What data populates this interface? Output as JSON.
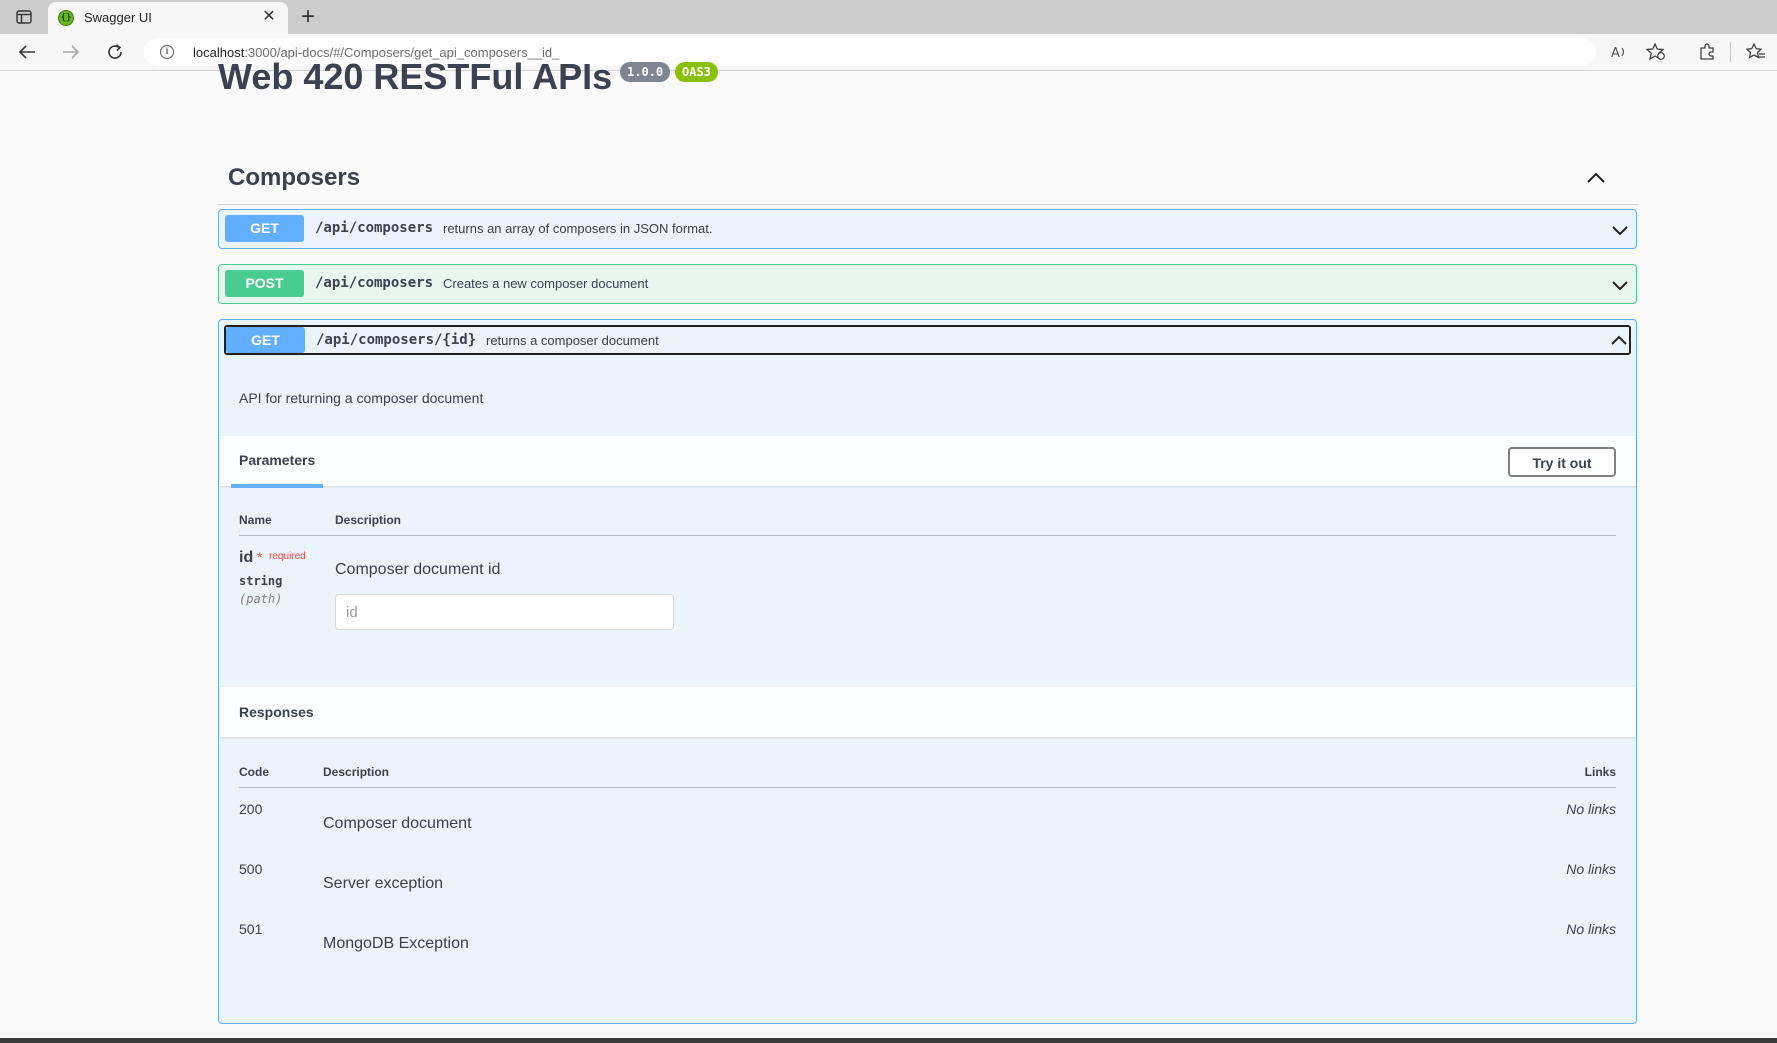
{
  "browser": {
    "tab_title": "Swagger UI",
    "url_host": "localhost",
    "url_rest": ":3000/api-docs/#/Composers/get_api_composers__id_"
  },
  "page": {
    "title": "Web 420 RESTFul APIs",
    "version_badge": "1.0.0",
    "oas_badge": "OAS3"
  },
  "section": {
    "title": "Composers"
  },
  "operations": [
    {
      "method": "GET",
      "path": "/api/composers",
      "summary": "returns an array of composers in JSON format."
    },
    {
      "method": "POST",
      "path": "/api/composers",
      "summary": "Creates a new composer document"
    },
    {
      "method": "GET",
      "path": "/api/composers/{id}",
      "summary": "returns a composer document"
    }
  ],
  "expanded": {
    "description": "API for returning a composer document",
    "parameters_tab": "Parameters",
    "try_button": "Try it out",
    "param_headers": {
      "name": "Name",
      "description": "Description"
    },
    "param": {
      "name": "id",
      "required_star": "*",
      "required_label": "required",
      "type": "string",
      "in": "(path)",
      "description": "Composer document id",
      "placeholder": "id"
    },
    "responses_title": "Responses",
    "resp_headers": {
      "code": "Code",
      "description": "Description",
      "links": "Links"
    },
    "responses": [
      {
        "code": "200",
        "description": "Composer document",
        "links": "No links"
      },
      {
        "code": "500",
        "description": "Server exception",
        "links": "No links"
      },
      {
        "code": "501",
        "description": "MongoDB Exception",
        "links": "No links"
      }
    ]
  }
}
